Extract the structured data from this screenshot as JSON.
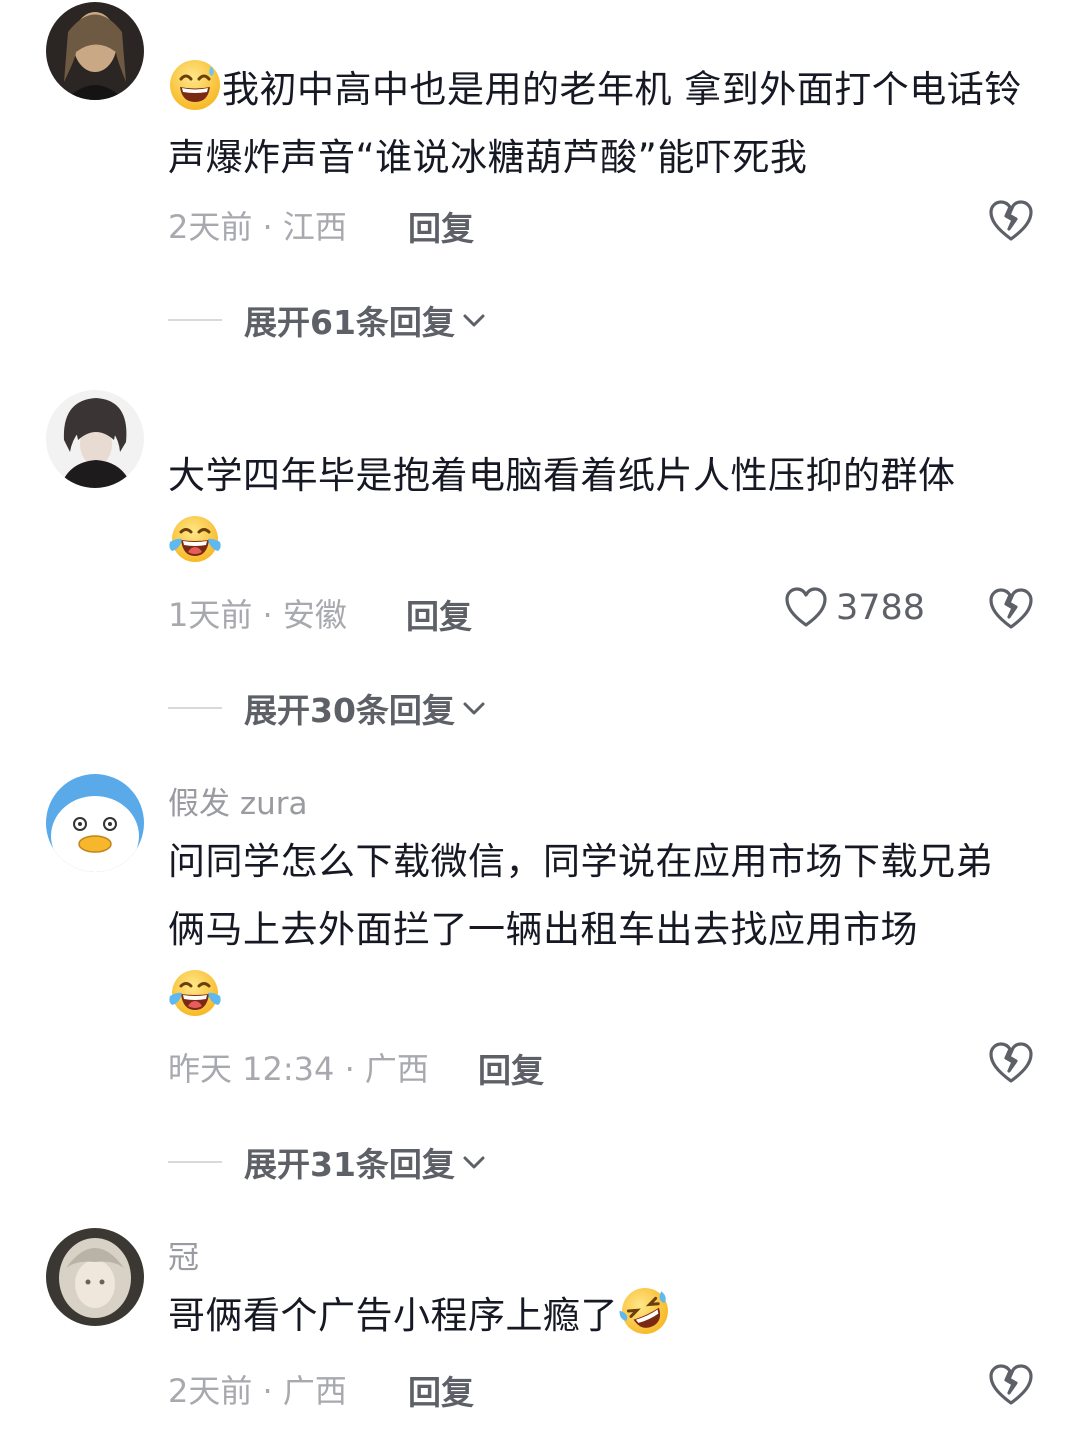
{
  "comments": [
    {
      "username": "",
      "text_before": "",
      "text": "我初中高中也是用的老年机 拿到外面打个电话铃声爆炸声音“谁说冰糖葫芦酸”能吓死我",
      "emoji_before": "grinning-sweat-emoji",
      "meta": "2天前 · 江西",
      "reply_label": "回复",
      "like_count": "",
      "expand_label": "展开61条回复"
    },
    {
      "username": "",
      "text": "大学四年毕是抱着电脑看着纸片人性压抑的群体",
      "emoji_after": "laughing-tears-emoji",
      "meta": "1天前 · 安徽",
      "reply_label": "回复",
      "like_count": "3788",
      "expand_label": "展开30条回复"
    },
    {
      "username": "假发 zura",
      "text": "问同学怎么下载微信，同学说在应用市场下载兄弟俩马上去外面拦了一辆出租车出去找应用市场",
      "emoji_after": "laughing-tears-emoji",
      "meta": "昨天 12:34 · 广西",
      "reply_label": "回复",
      "like_count": "",
      "expand_label": "展开31条回复"
    },
    {
      "username": "冠",
      "text": "哥俩看个广告小程序上瘾了",
      "emoji_after": "rolling-laughing-emoji",
      "meta": "2天前 · 广西",
      "reply_label": "回复",
      "like_count": ""
    }
  ],
  "colors": {
    "text": "#161823",
    "meta": "#a8a9ae",
    "action": "#5e6068",
    "emoji_yellow": "#ffcc33"
  }
}
